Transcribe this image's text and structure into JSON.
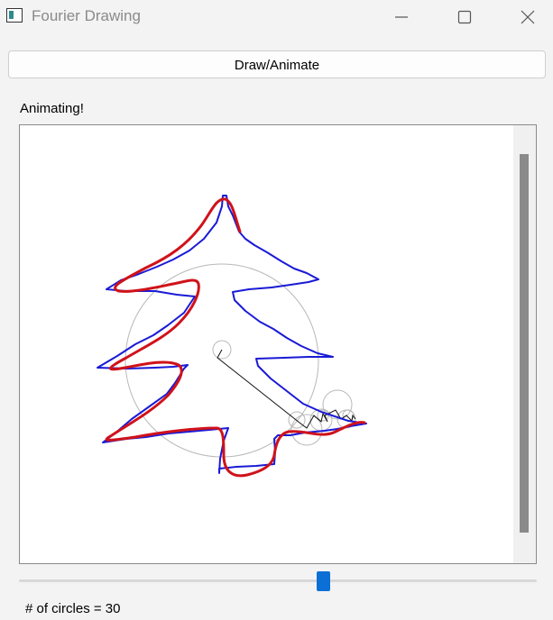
{
  "window": {
    "title": "Fourier Drawing",
    "minimize_icon": "minimize-icon",
    "maximize_icon": "maximize-icon",
    "close_icon": "close-icon"
  },
  "toolbar": {
    "draw_label": "Draw/Animate"
  },
  "status": {
    "text": "Animating!"
  },
  "slider": {
    "fraction": 0.59
  },
  "circles": {
    "label": "# of circles = 30"
  },
  "colors": {
    "traced_path": "#d0121a",
    "drawn_path": "#1a1ad6",
    "epicycles": "#b0b0b0",
    "slider_accent": "#0b6fd6"
  }
}
